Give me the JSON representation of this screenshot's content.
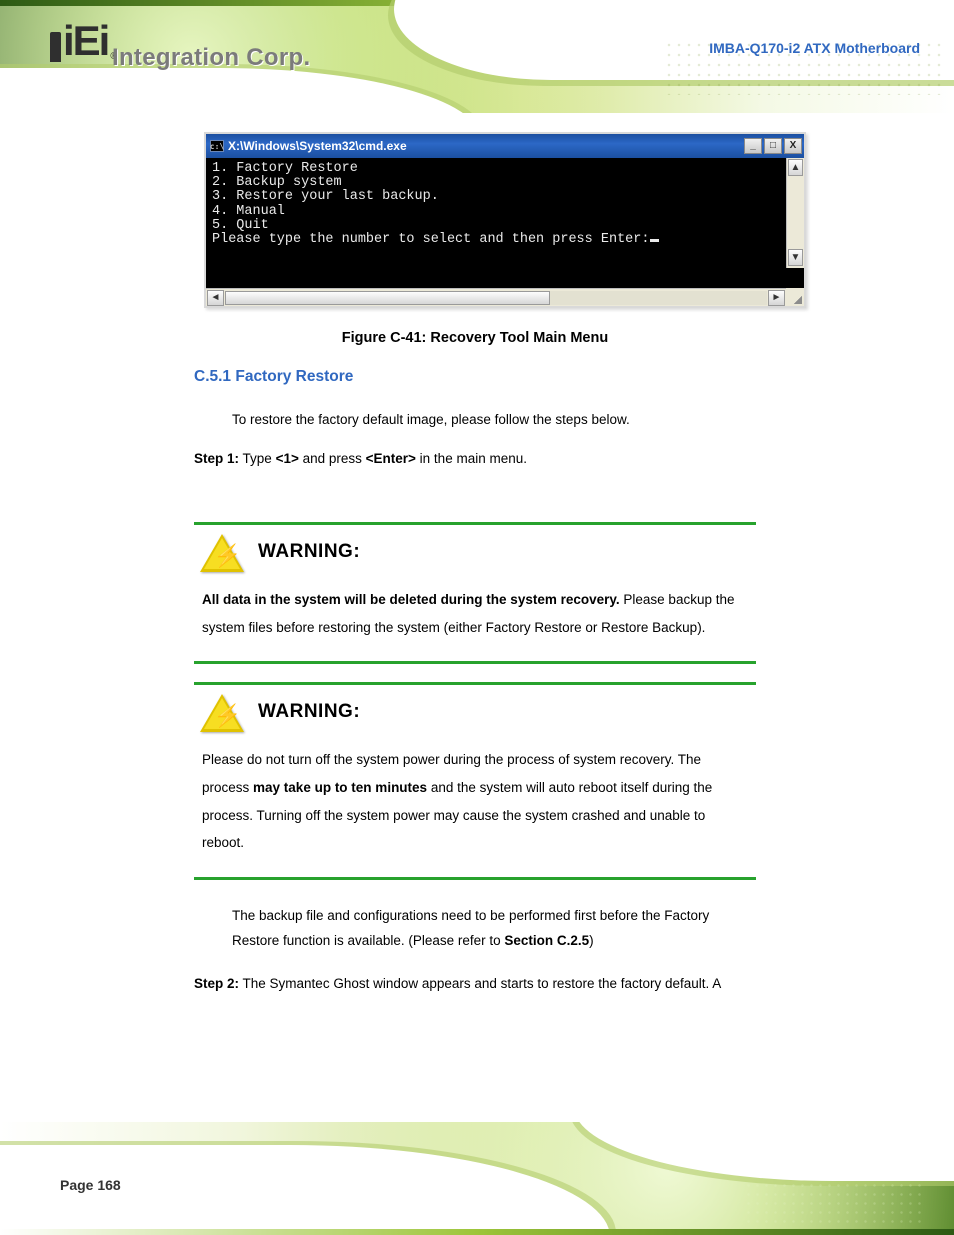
{
  "doc_title": "IMBA-Q170-i2 ATX Motherboard",
  "page_number": "Page 168",
  "logo_text": "iEi",
  "logo_reg": "®",
  "logo_tagline": "Integration Corp.",
  "cmd": {
    "title": "X:\\Windows\\System32\\cmd.exe",
    "items": [
      "1. Factory Restore",
      "2. Backup system",
      "3. Restore your last backup.",
      "4. Manual",
      "5. Quit"
    ],
    "prompt": "Please type the number to select and then press Enter:"
  },
  "figure_caption": "Figure C-41: Recovery Tool Main Menu",
  "section_heading": "C.5.1  Factory Restore",
  "intro": "To restore the factory default image, please follow the steps below.",
  "step1_label": "Step 1:",
  "step1_text_a": "Type ",
  "step1_key": "<1>",
  "step1_text_b": " and press ",
  "step1_enter": "<Enter>",
  "step1_text_c": " in the main menu.",
  "warning_label": "WARNING:",
  "warning1_lead": "All data in the system will be deleted during the system recovery.",
  "warning1_body": "Please backup the system files before restoring the system (either Factory Restore or Restore Backup).",
  "warning2_body_a": "Please do not turn off the system power during the process of system recovery. The process ",
  "warning2_body_b": "may take up to ten minutes",
  "warning2_body_c": " and the system will auto reboot itself during the process. Turning off the system power may cause the system crashed and unable to reboot.",
  "step2_lead": "The backup file and configurations need to be performed first before the Factory Restore function is available. (Please refer to ",
  "step2_ref": "Section C.2.5",
  "step2_lead_b": ")",
  "step2_label": "Step 2:",
  "step2_text": "The Symantec Ghost window appears and starts to restore the factory default. A"
}
